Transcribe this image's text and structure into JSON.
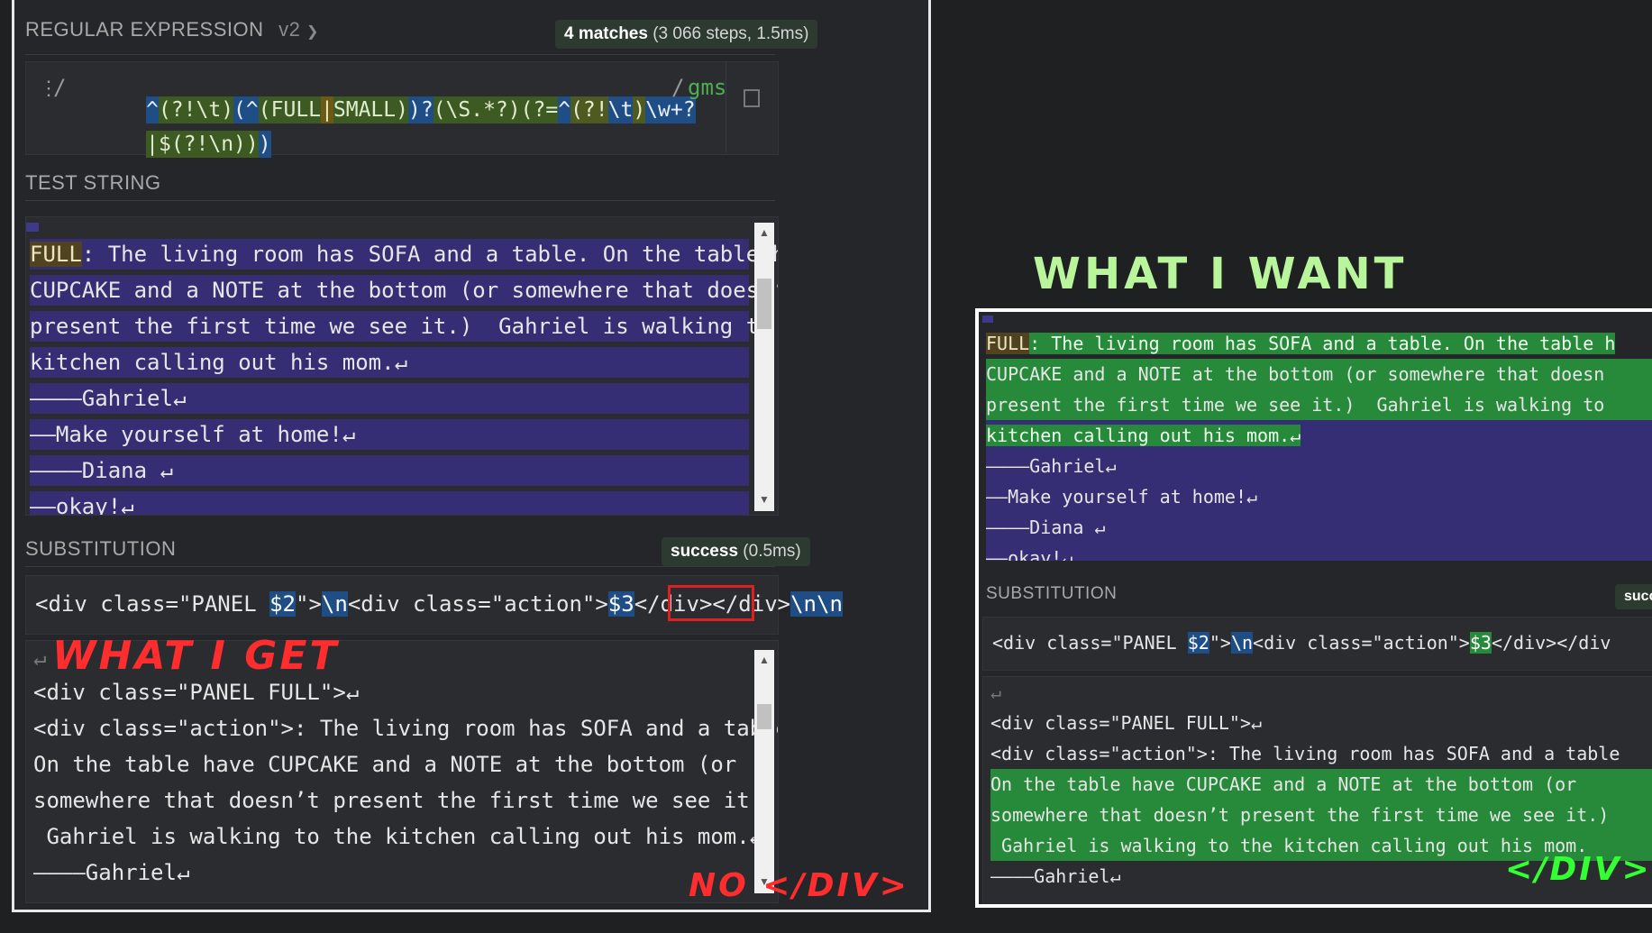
{
  "regex_section": {
    "title": "REGULAR EXPRESSION",
    "version": "v2",
    "matches_count": "4 matches",
    "matches_detail": "(3 066 steps, 1.5ms)",
    "delimiter_open": "/",
    "delimiter_close": "/",
    "flags": "gms",
    "pattern_line1_tokens": [
      "^",
      "(?!\\t)",
      "(",
      "^",
      "(",
      "FULL",
      "|",
      "SMALL",
      ")",
      ")?",
      "(",
      "\\S.*?",
      ")",
      "(?=",
      "^",
      "(?!",
      "\\t",
      ")",
      "\\w+?"
    ],
    "pattern_line2_tokens": [
      "|",
      "$",
      "(?!\\n)",
      ")",
      ")"
    ]
  },
  "test_string": {
    "title": "TEST STRING",
    "lines": [
      "FULL: The living room has SOFA and a table. On the table have ",
      "CUPCAKE and a NOTE at the bottom (or somewhere that doesn’t ",
      "present the first time we see it.)  Gahriel is walking to the ",
      "kitchen calling out his mom.↵",
      "————Gahriel↵",
      "——Make yourself at home!↵",
      "————Diana ↵",
      "——okay!↵"
    ]
  },
  "substitution": {
    "title": "SUBSTITUTION",
    "status": "success",
    "status_detail": "(0.5ms)",
    "parts": [
      "<div class=\"PANEL ",
      "$2",
      "\">",
      "\\n",
      "<div class=\"action\">",
      "$3",
      "</div>",
      "</div>",
      "\\n\\n"
    ]
  },
  "output": {
    "lines": [
      "↵",
      "<div class=\"PANEL FULL\">↵",
      "<div class=\"action\">: The living room has SOFA and a table. ",
      "On the table have CUPCAKE and a NOTE at the bottom (or ",
      "somewhere that doesn’t present the first time we see it.) ",
      " Gahriel is walking to the kitchen calling out his mom.↵",
      "————Gahriel↵"
    ]
  },
  "annotations": {
    "what_i_get": "WHAT I GET",
    "no_div": "NO </DIV>",
    "what_i_want": "WHAT I WANT",
    "div": "</DIV>"
  },
  "right_panel": {
    "test_lines": [
      "FULL: The living room has SOFA and a table. On the table h",
      "CUPCAKE and a NOTE at the bottom (or somewhere that doesn",
      "present the first time we see it.)  Gahriel is walking to",
      "kitchen calling out his mom.↵",
      "————Gahriel↵",
      "——Make yourself at home!↵",
      "————Diana ↵",
      "——okay!↵"
    ],
    "sub_title": "SUBSTITUTION",
    "sub_status": "succ",
    "sub_parts": [
      "<div class=\"PANEL ",
      "$2",
      "\">",
      "\\n",
      "<div class=\"action\">",
      "$3",
      "</div></div"
    ],
    "out_lines": [
      "↵",
      "<div class=\"PANEL FULL\">↵",
      "<div class=\"action\">: The living room has SOFA and a table",
      "On the table have CUPCAKE and a NOTE at the bottom (or ",
      "somewhere that doesn’t present the first time we see it.)",
      " Gahriel is walking to the kitchen calling out his mom.",
      "————Gahriel↵"
    ]
  },
  "colors": {
    "match_bg": "#352e75",
    "group_blue": "#1f4e87",
    "green_highlight": "#278a3b",
    "annotation_red": "#ff2d2d",
    "annotation_green": "#33ff33"
  }
}
